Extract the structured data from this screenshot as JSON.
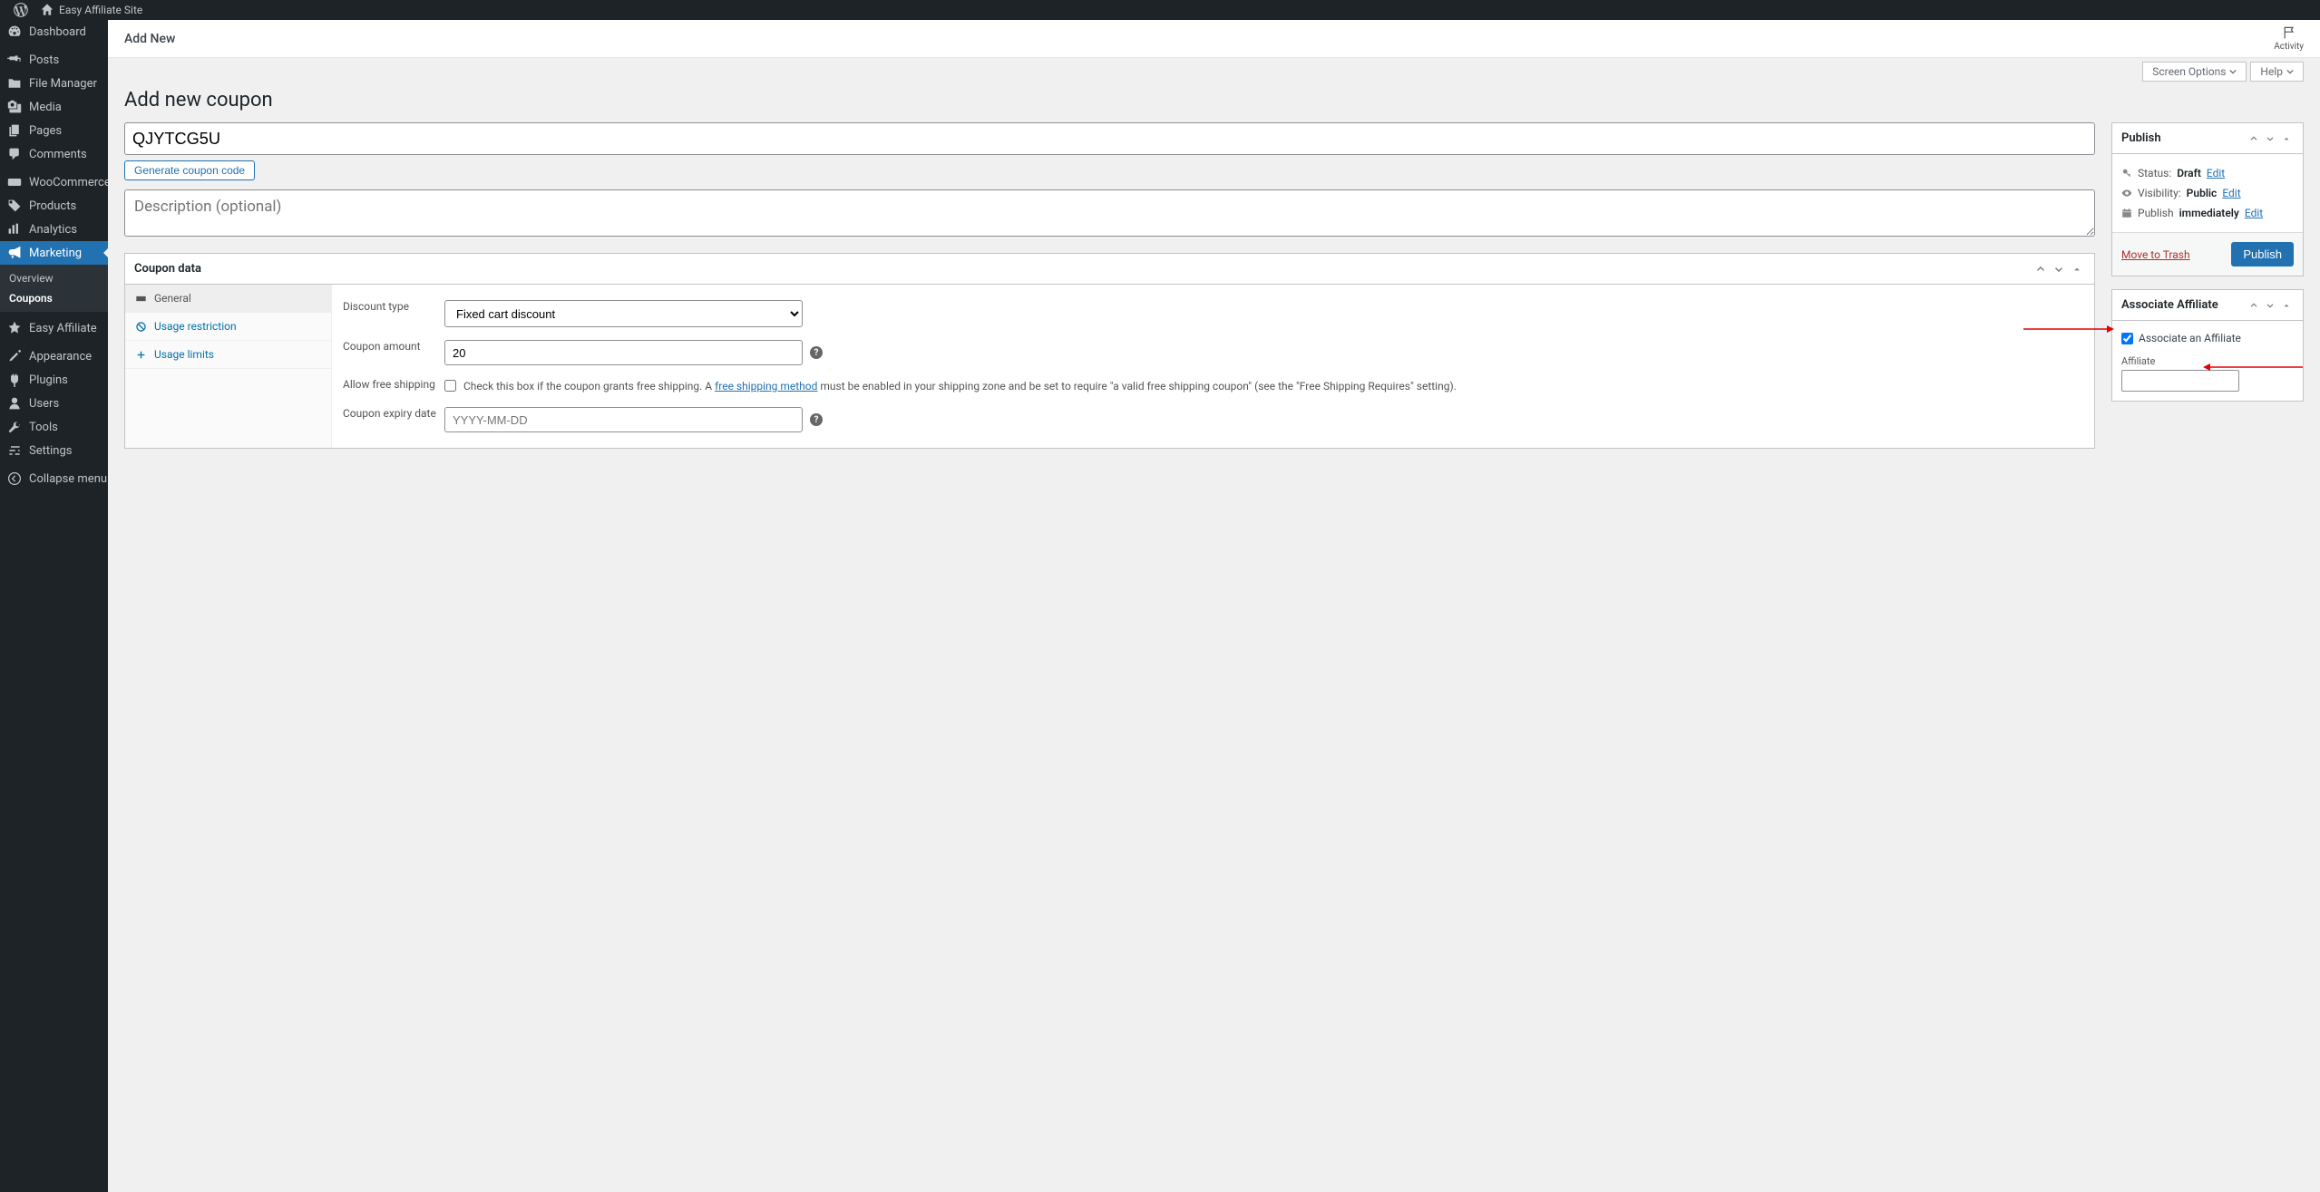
{
  "adminbar": {
    "site_name": "Easy Affiliate Site"
  },
  "sidebar": {
    "items": [
      {
        "label": "Dashboard"
      },
      {
        "label": "Posts"
      },
      {
        "label": "File Manager"
      },
      {
        "label": "Media"
      },
      {
        "label": "Pages"
      },
      {
        "label": "Comments"
      },
      {
        "label": "WooCommerce"
      },
      {
        "label": "Products"
      },
      {
        "label": "Analytics"
      },
      {
        "label": "Marketing"
      },
      {
        "label": "Easy Affiliate"
      },
      {
        "label": "Appearance"
      },
      {
        "label": "Plugins"
      },
      {
        "label": "Users"
      },
      {
        "label": "Tools"
      },
      {
        "label": "Settings"
      },
      {
        "label": "Collapse menu"
      }
    ],
    "submenu": {
      "overview": "Overview",
      "coupons": "Coupons"
    }
  },
  "tabbar": {
    "addnew": "Add New",
    "activity": "Activity"
  },
  "screen_meta": {
    "screen_options": "Screen Options",
    "help": "Help"
  },
  "page": {
    "title": "Add new coupon",
    "coupon_code": "QJYTCG5U",
    "generate_btn": "Generate coupon code",
    "desc_placeholder": "Description (optional)"
  },
  "coupondata": {
    "title": "Coupon data",
    "tabs": {
      "general": "General",
      "usage_restriction": "Usage restriction",
      "usage_limits": "Usage limits"
    },
    "discount_type_label": "Discount type",
    "discount_type_value": "Fixed cart discount",
    "amount_label": "Coupon amount",
    "amount_value": "20",
    "free_ship_label": "Allow free shipping",
    "free_ship_desc_pre": "Check this box if the coupon grants free shipping. A ",
    "free_ship_link": "free shipping method",
    "free_ship_desc_post": " must be enabled in your shipping zone and be set to require \"a valid free shipping coupon\" (see the \"Free Shipping Requires\" setting).",
    "expiry_label": "Coupon expiry date",
    "expiry_placeholder": "YYYY-MM-DD"
  },
  "publish": {
    "title": "Publish",
    "status_label": "Status:",
    "status_value": "Draft",
    "visibility_label": "Visibility:",
    "visibility_value": "Public",
    "schedule_label": "Publish",
    "schedule_value": "immediately",
    "edit": "Edit",
    "trash": "Move to Trash",
    "publish_btn": "Publish"
  },
  "associate": {
    "title": "Associate Affiliate",
    "checkbox_label": "Associate an Affiliate",
    "checked": true,
    "field_label": "Affiliate",
    "field_value": ""
  }
}
